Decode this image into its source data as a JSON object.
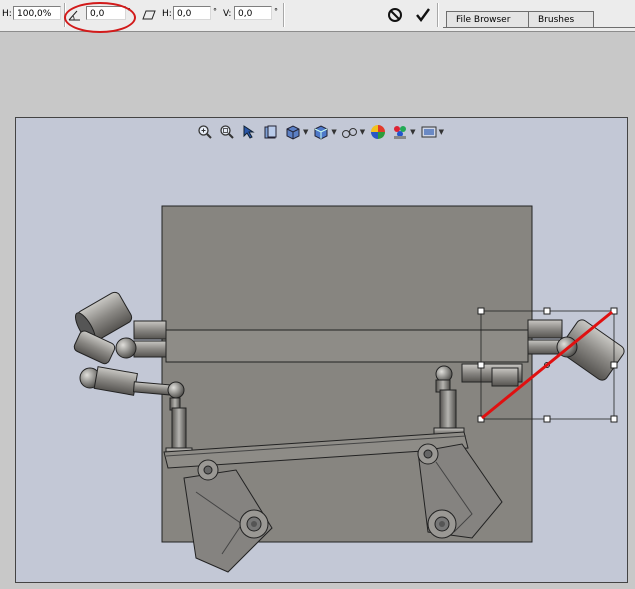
{
  "options_bar": {
    "width_label": "H:",
    "width_value": "100,0%",
    "angle_value": "0,0",
    "angle_unit": "°",
    "hskew_label": "H:",
    "hskew_value": "0,0",
    "hskew_unit": "°",
    "vskew_label": "V:",
    "vskew_value": "0,0",
    "vskew_unit": "°",
    "cancel_icon": "cancel-icon",
    "commit_icon": "checkmark-icon"
  },
  "palette_tabs": [
    "File Browser",
    "Brushes"
  ],
  "annotation": {
    "highlight_color": "#d21a1a"
  },
  "view_toolbar": {
    "icons": [
      "zoom-in-icon",
      "zoom-fit-icon",
      "select-icon",
      "section-icon",
      "orientation-icon",
      "view-cube-icon",
      "hide-show-icon",
      "appearance-icon",
      "scene-icon",
      "display-settings-icon"
    ]
  },
  "colors": {
    "viewport_bg": "#c3c8d6",
    "plate": "#878580",
    "diagonal_line": "#e01010"
  }
}
